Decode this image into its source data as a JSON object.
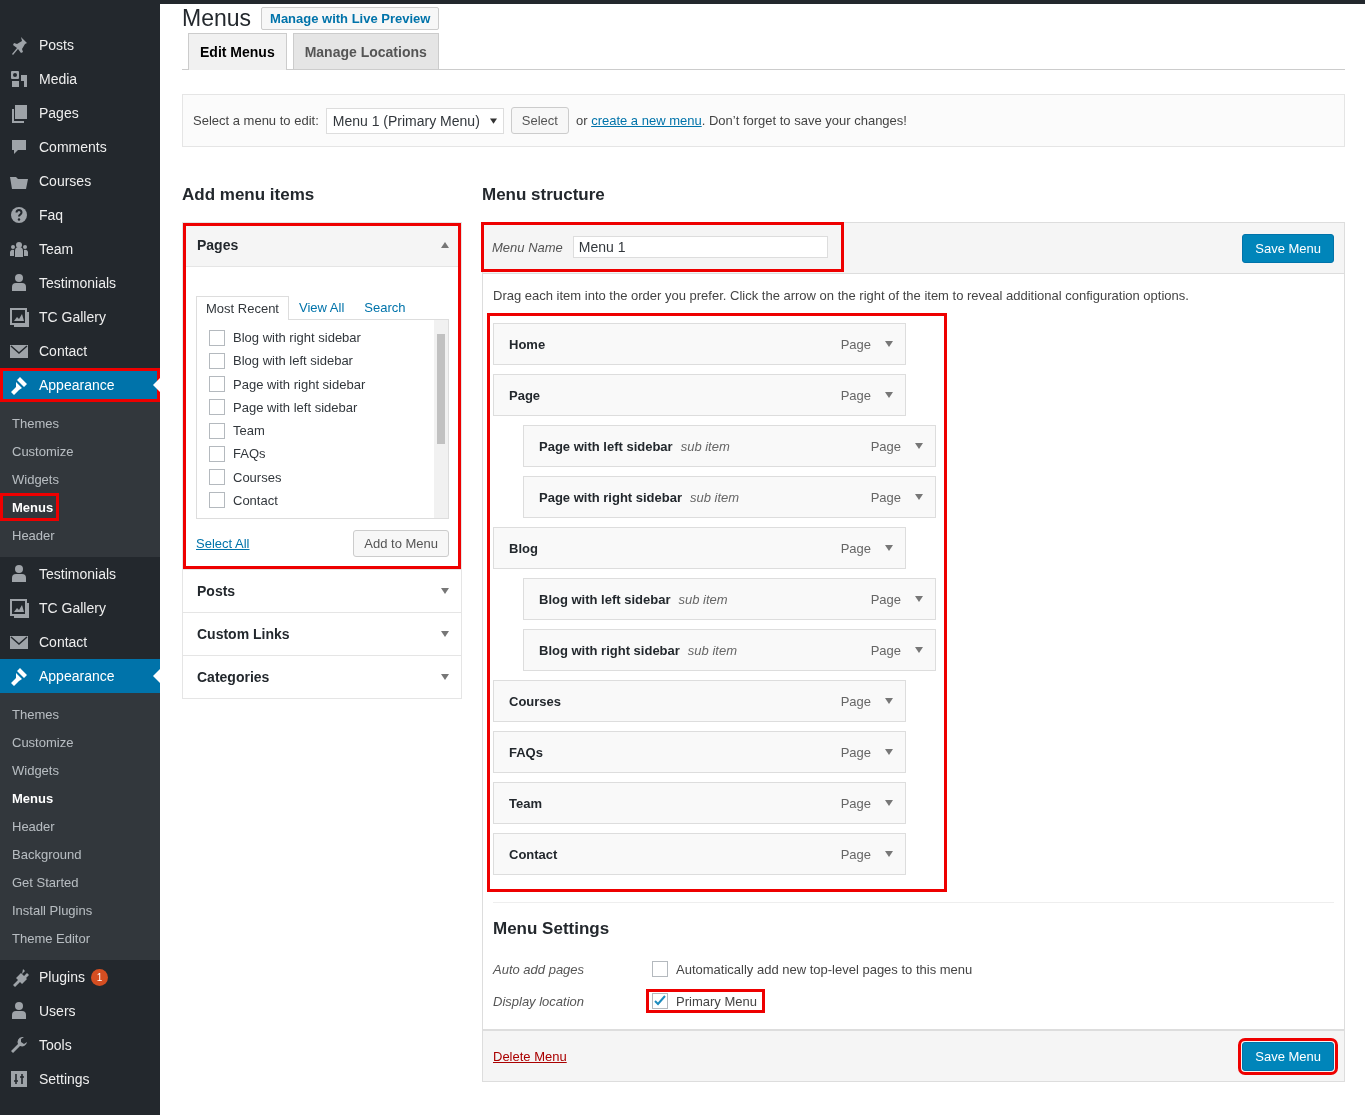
{
  "sidebar": {
    "items": [
      {
        "label": "Posts",
        "selected": false,
        "highlighted": false
      },
      {
        "label": "Media",
        "selected": false,
        "highlighted": false
      },
      {
        "label": "Pages",
        "selected": false,
        "highlighted": false
      },
      {
        "label": "Comments",
        "selected": false,
        "highlighted": false
      },
      {
        "label": "Courses",
        "selected": false,
        "highlighted": false
      },
      {
        "label": "Faq",
        "selected": false,
        "highlighted": false
      },
      {
        "label": "Team",
        "selected": false,
        "highlighted": false
      },
      {
        "label": "Testimonials",
        "selected": false,
        "highlighted": false
      },
      {
        "label": "TC Gallery",
        "selected": false,
        "highlighted": false
      },
      {
        "label": "Contact",
        "selected": false,
        "highlighted": false
      },
      {
        "label": "Appearance",
        "selected": true,
        "highlighted": true,
        "children": [
          {
            "label": "Themes",
            "selected": false,
            "highlighted": false
          },
          {
            "label": "Customize",
            "selected": false,
            "highlighted": false
          },
          {
            "label": "Widgets",
            "selected": false,
            "highlighted": false
          },
          {
            "label": "Menus",
            "selected": true,
            "highlighted": true
          },
          {
            "label": "Header",
            "selected": false,
            "highlighted": false
          }
        ]
      },
      {
        "label": "Testimonials",
        "selected": false,
        "highlighted": false
      },
      {
        "label": "TC Gallery",
        "selected": false,
        "highlighted": false
      },
      {
        "label": "Contact",
        "selected": false,
        "highlighted": false
      },
      {
        "label": "Appearance",
        "selected": true,
        "highlighted": false,
        "children": [
          {
            "label": "Themes",
            "selected": false,
            "highlighted": false
          },
          {
            "label": "Customize",
            "selected": false,
            "highlighted": false
          },
          {
            "label": "Widgets",
            "selected": false,
            "highlighted": false
          },
          {
            "label": "Menus",
            "selected": true,
            "highlighted": false
          },
          {
            "label": "Header",
            "selected": false,
            "highlighted": false
          },
          {
            "label": "Background",
            "selected": false,
            "highlighted": false
          },
          {
            "label": "Get Started",
            "selected": false,
            "highlighted": false
          },
          {
            "label": "Install Plugins",
            "selected": false,
            "highlighted": false
          },
          {
            "label": "Theme Editor",
            "selected": false,
            "highlighted": false
          }
        ]
      },
      {
        "label": "Plugins",
        "badge": "1",
        "selected": false,
        "highlighted": false
      },
      {
        "label": "Users",
        "selected": false,
        "highlighted": false
      },
      {
        "label": "Tools",
        "selected": false,
        "highlighted": false
      },
      {
        "label": "Settings",
        "selected": false,
        "highlighted": false
      }
    ]
  },
  "page": {
    "title": "Menus",
    "title_button": "Manage with Live Preview"
  },
  "tabs": [
    {
      "label": "Edit Menus",
      "selected": true
    },
    {
      "label": "Manage Locations",
      "selected": false
    }
  ],
  "menu_select": {
    "label": "Select a menu to edit:",
    "value": "Menu 1 (Primary Menu)",
    "button": "Select",
    "text_before": "or",
    "link": "create a new menu",
    "text_after": ". Don’t forget to save your changes!"
  },
  "add_items": {
    "heading": "Add menu items",
    "panels": [
      {
        "title": "Pages",
        "expanded": true,
        "highlighted": true,
        "tabs": [
          {
            "label": "Most Recent",
            "selected": true
          },
          {
            "label": "View All",
            "selected": false
          },
          {
            "label": "Search",
            "selected": false
          }
        ],
        "items": [
          {
            "label": "Blog with right sidebar",
            "checked": false
          },
          {
            "label": "Blog with left sidebar",
            "checked": false
          },
          {
            "label": "Page with right sidebar",
            "checked": false
          },
          {
            "label": "Page with left sidebar",
            "checked": false
          },
          {
            "label": "Team",
            "checked": false
          },
          {
            "label": "FAQs",
            "checked": false
          },
          {
            "label": "Courses",
            "checked": false
          },
          {
            "label": "Contact",
            "checked": false
          }
        ],
        "select_all": "Select All",
        "add_button": "Add to Menu"
      },
      {
        "title": "Posts",
        "expanded": false,
        "highlighted": false
      },
      {
        "title": "Custom Links",
        "expanded": false,
        "highlighted": false
      },
      {
        "title": "Categories",
        "expanded": false,
        "highlighted": false
      }
    ]
  },
  "structure": {
    "heading": "Menu structure",
    "name_label": "Menu Name",
    "name_value": "Menu 1",
    "name_highlighted": true,
    "save_button": "Save Menu",
    "instructions": "Drag each item into the order you prefer. Click the arrow on the right of the item to reveal additional configuration options.",
    "items_highlighted": true,
    "items": [
      {
        "title": "Home",
        "type": "Page"
      },
      {
        "title": "Page",
        "type": "Page",
        "children": [
          {
            "title": "Page with left sidebar",
            "sub_label": "sub item",
            "type": "Page"
          },
          {
            "title": "Page with right sidebar",
            "sub_label": "sub item",
            "type": "Page"
          }
        ]
      },
      {
        "title": "Blog",
        "type": "Page",
        "children": [
          {
            "title": "Blog with left sidebar",
            "sub_label": "sub item",
            "type": "Page"
          },
          {
            "title": "Blog with right sidebar",
            "sub_label": "sub item",
            "type": "Page"
          }
        ]
      },
      {
        "title": "Courses",
        "type": "Page"
      },
      {
        "title": "FAQs",
        "type": "Page"
      },
      {
        "title": "Team",
        "type": "Page"
      },
      {
        "title": "Contact",
        "type": "Page"
      }
    ]
  },
  "settings": {
    "heading": "Menu Settings",
    "rows": [
      {
        "label": "Auto add pages",
        "option": "Automatically add new top-level pages to this menu",
        "checked": false,
        "highlighted": false
      },
      {
        "label": "Display location",
        "option": "Primary Menu",
        "checked": true,
        "highlighted": true
      }
    ]
  },
  "footer": {
    "delete_link": "Delete Menu",
    "save_button": "Save Menu",
    "save_highlighted": true
  }
}
